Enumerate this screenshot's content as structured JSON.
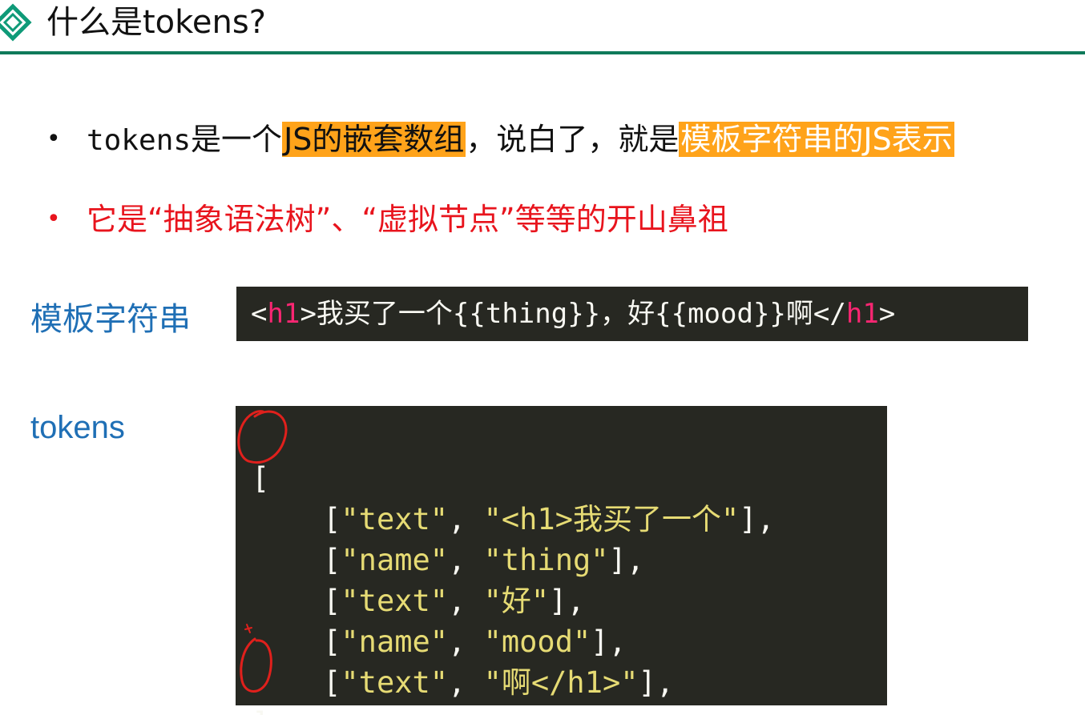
{
  "header": {
    "title": "什么是tokens?",
    "rule_color": "#0f7a5a"
  },
  "bullets": [
    {
      "dot": "•",
      "segments": [
        "tokens",
        "是一个",
        "JS的嵌套数组",
        "，说白了，就是",
        "模板字符串的JS表示"
      ],
      "highlight_color": "#ffa31a"
    },
    {
      "dot": "•",
      "text": "它是“抽象语法树”、“虚拟节点”等等的开山鼻祖",
      "color": "#e8141d"
    }
  ],
  "template_section": {
    "label": "模板字符串",
    "code": {
      "open_lt": "<",
      "open_tag": "h1",
      "body": ">我买了一个{{thing}}，好{{mood}}啊</",
      "close_tag": "h1",
      "close_gt": ">"
    }
  },
  "tokens_section": {
    "label": "tokens",
    "open_bracket": "[",
    "close_bracket": "]",
    "rows": [
      {
        "type": "\"text\"",
        "value": "\"<h1>我买了一个\""
      },
      {
        "type": "\"name\"",
        "value": "\"thing\""
      },
      {
        "type": "\"text\"",
        "value": "\"好\""
      },
      {
        "type": "\"name\"",
        "value": "\"mood\""
      },
      {
        "type": "\"text\"",
        "value": "\"啊</h1>\""
      }
    ],
    "row_prefix": "    [",
    "row_sep": ", ",
    "row_suffix": "],"
  },
  "colors": {
    "label_blue": "#1f6fb5",
    "code_bg": "#272822",
    "code_string": "#e6db74",
    "code_tag": "#f92672",
    "annotation_red": "#e0201c"
  },
  "icons": {
    "logo": "diamond-logo-icon"
  }
}
